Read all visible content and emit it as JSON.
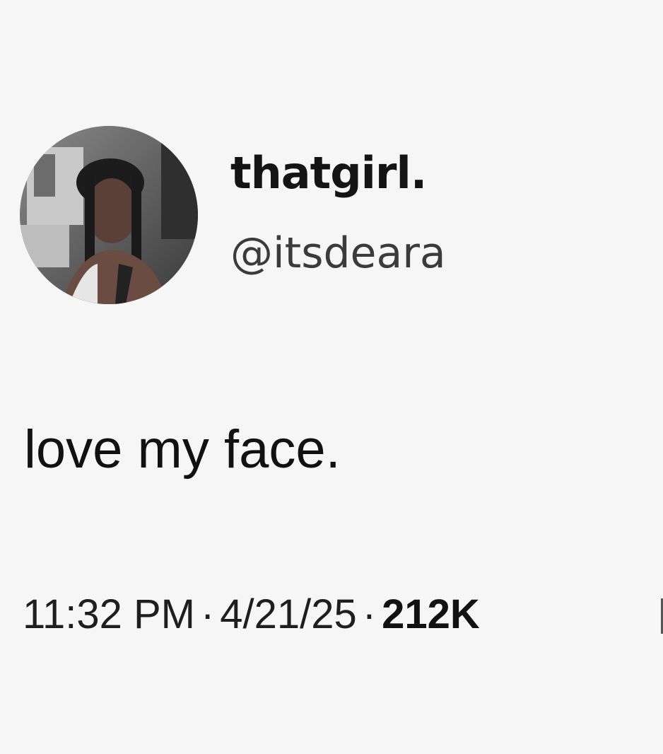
{
  "user": {
    "display_name": "thatgirl.",
    "handle": "@itsdeara",
    "avatar_icon": "profile-photo"
  },
  "tweet": {
    "text": "love my face."
  },
  "meta": {
    "time": "11:32 PM",
    "separator": "·",
    "date": "4/21/25",
    "views": "212K"
  },
  "colors": {
    "background": "#f6f6f6",
    "text": "#141414",
    "handle": "#3b3b3b"
  }
}
